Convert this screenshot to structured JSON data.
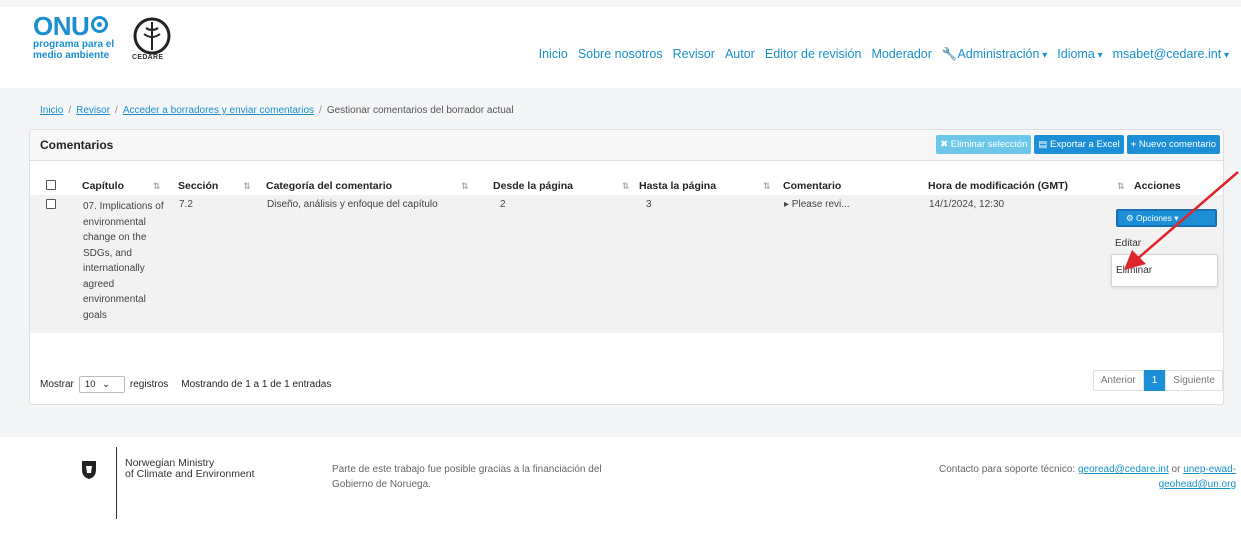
{
  "header": {
    "logo_onu": "ONU",
    "logo_sub1": "programa para el",
    "logo_sub2": "medio ambiente",
    "logo_cedare": "CEDARE",
    "nav": [
      "Inicio",
      "Sobre nosotros",
      "Revisor",
      "Autor",
      "Editor de revisión",
      "Moderador",
      "Administración",
      "Idioma",
      "msabet@cedare.int"
    ]
  },
  "breadcrumb": [
    "Inicio",
    "Revisor",
    "Acceder a borradores y enviar comentarios",
    "Gestionar comentarios del borrador actual"
  ],
  "card": {
    "title": "Comentarios",
    "buttons": {
      "delete": "Eliminar selección",
      "export": "Exportar a Excel",
      "new": "Nuevo comentario"
    }
  },
  "table": {
    "headers": [
      "Capítulo",
      "Sección",
      "Categoría del comentario",
      "Desde la página",
      "Hasta la página",
      "Comentario",
      "Hora de modificación (GMT)",
      "Acciones"
    ],
    "rows": [
      {
        "chapter": "07. Implications of environmental change on the SDGs, and internationally agreed environmental goals",
        "section": "7.2",
        "category": "Diseño, análisis y enfoque del capítulo",
        "from": "2",
        "to": "3",
        "comment": "▸ Please revi...",
        "modified": "14/1/2024, 12:30",
        "action": "Opciones"
      }
    ]
  },
  "dropdown": {
    "edit": "Editar",
    "delete": "Eliminar"
  },
  "footer_table": {
    "show": "Mostrar",
    "length": "10",
    "records": "registros",
    "info": "Mostrando de 1 a 1 de 1 entradas",
    "prev": "Anterior",
    "page": "1",
    "next": "Siguiente"
  },
  "footer": {
    "ministry1": "Norwegian Ministry",
    "ministry2": "of Climate and Environment",
    "funding": "Parte de este trabajo fue posible gracias a la financiación del Gobierno de Noruega.",
    "contact_prefix": "Contacto para soporte técnico: ",
    "email1": "georead@cedare.int",
    "or": " or ",
    "email2": "unep-ewad-geohead@un.org"
  }
}
